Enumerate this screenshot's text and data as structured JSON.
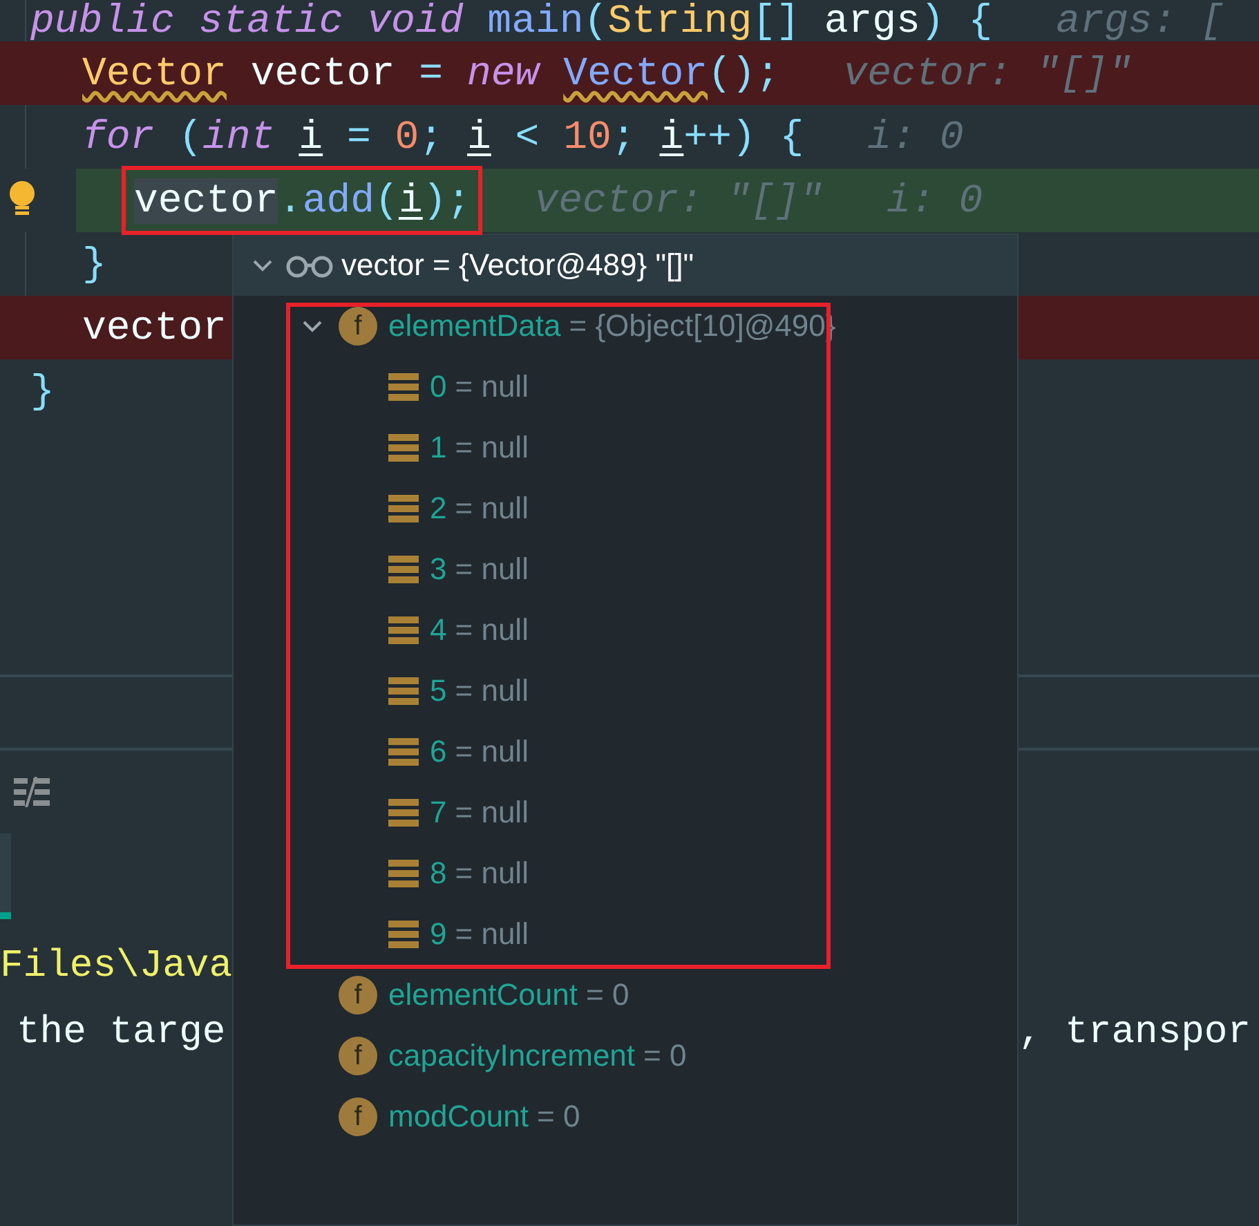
{
  "editor": {
    "lines": [
      {
        "tokens": [
          {
            "kind": "kw",
            "text": "public static void"
          },
          {
            "kind": "method",
            "text": " main"
          },
          {
            "kind": "punct",
            "text": "("
          },
          {
            "kind": "class",
            "text": "String"
          },
          {
            "kind": "punct",
            "text": "[]"
          },
          {
            "kind": "plain",
            "text": " args"
          },
          {
            "kind": "punct",
            "text": ") {"
          }
        ],
        "hints": [
          "args: ["
        ],
        "children": [
          {
            "kind": "breakpoint",
            "tokens": [
              {
                "kind": "type",
                "text": "Vector"
              },
              {
                "kind": "plain",
                "text": " vector "
              },
              {
                "kind": "punct",
                "text": "= "
              },
              {
                "kind": "kw",
                "text": "new "
              },
              {
                "kind": "ctor",
                "text": "Vector"
              },
              {
                "kind": "punct",
                "text": "();"
              }
            ],
            "hints": [
              "vector: \"[]\""
            ]
          },
          {
            "tokens": [
              {
                "kind": "kw",
                "text": "for"
              },
              {
                "kind": "punct",
                "text": " ("
              },
              {
                "kind": "kw",
                "text": "int "
              },
              {
                "kind": "var",
                "text": "i"
              },
              {
                "kind": "punct",
                "text": " = "
              },
              {
                "kind": "num",
                "text": "0"
              },
              {
                "kind": "punct",
                "text": "; "
              },
              {
                "kind": "var",
                "text": "i"
              },
              {
                "kind": "punct",
                "text": " < "
              },
              {
                "kind": "num",
                "text": "10"
              },
              {
                "kind": "punct",
                "text": "; "
              },
              {
                "kind": "var",
                "text": "i"
              },
              {
                "kind": "punct",
                "text": "++) {"
              }
            ],
            "hints": [
              "i: 0"
            ],
            "children": [
              {
                "kind": "current",
                "tokens": [
                  {
                    "kind": "hl",
                    "text": "vector"
                  },
                  {
                    "kind": "punct",
                    "text": "."
                  },
                  {
                    "kind": "method",
                    "text": "add"
                  },
                  {
                    "kind": "punct",
                    "text": "("
                  },
                  {
                    "kind": "var",
                    "text": "i"
                  },
                  {
                    "kind": "punct",
                    "text": ");"
                  }
                ],
                "hints": [
                  "vector: \"[]\"",
                  "i: 0"
                ]
              }
            ]
          },
          {
            "tokens": [
              {
                "kind": "punct",
                "text": "}"
              }
            ]
          },
          {
            "kind": "breakpoint",
            "tokens": [
              {
                "kind": "plain",
                "text": "vector"
              }
            ]
          }
        ]
      },
      {
        "tokens": [
          {
            "kind": "punct",
            "text": "}"
          }
        ]
      }
    ]
  },
  "popup": {
    "header": {
      "text": "vector = {Vector@489} \"[]\"",
      "expanded": true
    },
    "items": [
      {
        "kind": "field",
        "badge": "f",
        "name": "elementData",
        "value": "= {Object[10]@490}",
        "expanded": true,
        "children": [
          {
            "kind": "element",
            "name": "0",
            "value": "= null"
          },
          {
            "kind": "element",
            "name": "1",
            "value": "= null"
          },
          {
            "kind": "element",
            "name": "2",
            "value": "= null"
          },
          {
            "kind": "element",
            "name": "3",
            "value": "= null"
          },
          {
            "kind": "element",
            "name": "4",
            "value": "= null"
          },
          {
            "kind": "element",
            "name": "5",
            "value": "= null"
          },
          {
            "kind": "element",
            "name": "6",
            "value": "= null"
          },
          {
            "kind": "element",
            "name": "7",
            "value": "= null"
          },
          {
            "kind": "element",
            "name": "8",
            "value": "= null"
          },
          {
            "kind": "element",
            "name": "9",
            "value": "= null"
          }
        ]
      },
      {
        "kind": "field",
        "badge": "f",
        "name": "elementCount",
        "value": "= 0"
      },
      {
        "kind": "field",
        "badge": "f",
        "name": "capacityIncrement",
        "value": "= 0"
      },
      {
        "kind": "field",
        "badge": "f",
        "name": "modCount",
        "value": "= 0"
      }
    ]
  },
  "console": {
    "lines": [
      {
        "kind": "path",
        "left": "Files\\Java"
      },
      {
        "kind": "output",
        "left": "the targe",
        "right": ", transpor"
      }
    ]
  }
}
